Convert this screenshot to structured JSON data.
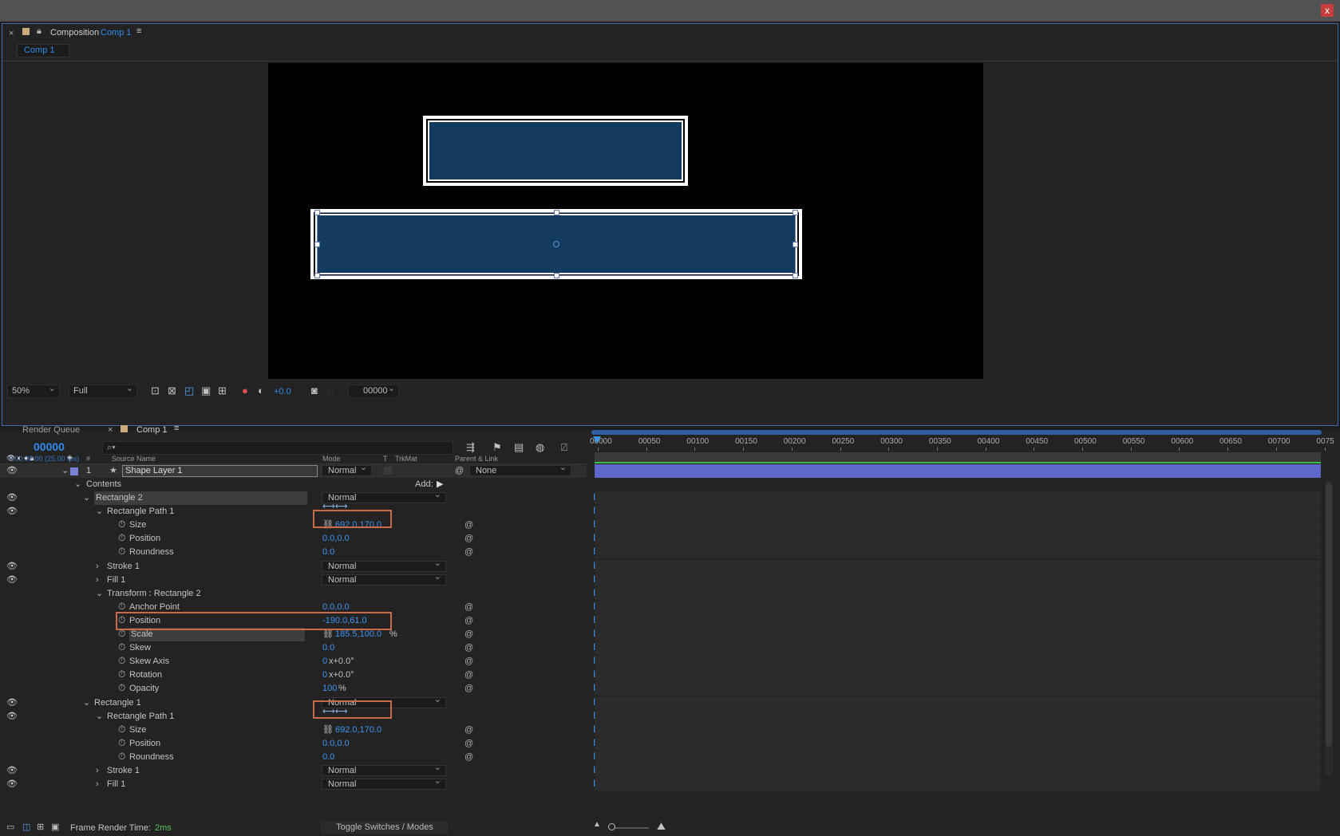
{
  "window": {
    "close": "x"
  },
  "comp_panel": {
    "close": "×",
    "title": "Composition",
    "comp_name": "Comp 1",
    "tab": "Comp 1"
  },
  "viewer": {
    "zoom": "50%",
    "resolution": "Full",
    "exposure": "+0.0",
    "timecode": "00000"
  },
  "timeline_tabs": {
    "render_queue": "Render Queue",
    "close": "×",
    "comp_tab": "Comp 1"
  },
  "timeline": {
    "current_frame": "00000",
    "timecode": "0:00:00:00 (25.00 fps)",
    "search_placeholder": "⌕▾",
    "columns": {
      "num": "#",
      "source": "Source Name",
      "mode": "Mode",
      "t": "T",
      "trkmat": "TrkMat",
      "parent": "Parent & Link"
    },
    "ruler": [
      "00000",
      "00050",
      "00100",
      "00150",
      "00200",
      "00250",
      "00300",
      "00350",
      "00400",
      "00450",
      "00500",
      "00550",
      "00600",
      "00650",
      "00700",
      "0075"
    ],
    "layer": {
      "index": "1",
      "name": "Shape Layer 1",
      "mode": "Normal",
      "parent": "None"
    },
    "contents": "Contents",
    "add": "Add:",
    "rows": [
      {
        "label": "Rectangle 2",
        "mode": "Normal",
        "hl": true
      },
      {
        "label": "Rectangle Path 1"
      },
      {
        "label": "Size",
        "value": "692.0,170.0"
      },
      {
        "label": "Position",
        "value": "0.0,0.0"
      },
      {
        "label": "Roundness",
        "value": "0.0"
      },
      {
        "label": "Stroke 1",
        "mode": "Normal"
      },
      {
        "label": "Fill 1",
        "mode": "Normal"
      },
      {
        "label": "Transform : Rectangle 2"
      },
      {
        "label": "Anchor Point",
        "value": "0.0,0.0"
      },
      {
        "label": "Position",
        "value": "-190.0,61.0"
      },
      {
        "label": "Scale",
        "value": "185.5,100.0",
        "unit": "%"
      },
      {
        "label": "Skew",
        "value": "0.0"
      },
      {
        "label": "Skew Axis",
        "value": "0",
        "unit": "x+0.0°"
      },
      {
        "label": "Rotation",
        "value": "0",
        "unit": "x+0.0°"
      },
      {
        "label": "Opacity",
        "value": "100",
        "unit": "%"
      },
      {
        "label": "Rectangle 1",
        "mode": "Normal"
      },
      {
        "label": "Rectangle Path 1"
      },
      {
        "label": "Size",
        "value": "692.0,170.0"
      },
      {
        "label": "Position",
        "value": "0.0,0.0"
      },
      {
        "label": "Roundness",
        "value": "0.0"
      },
      {
        "label": "Stroke 1",
        "mode": "Normal"
      },
      {
        "label": "Fill 1",
        "mode": "Normal"
      }
    ]
  },
  "footer": {
    "frame_render_label": "Frame Render Time:",
    "frame_render_value": "2ms",
    "toggle": "Toggle Switches / Modes"
  }
}
